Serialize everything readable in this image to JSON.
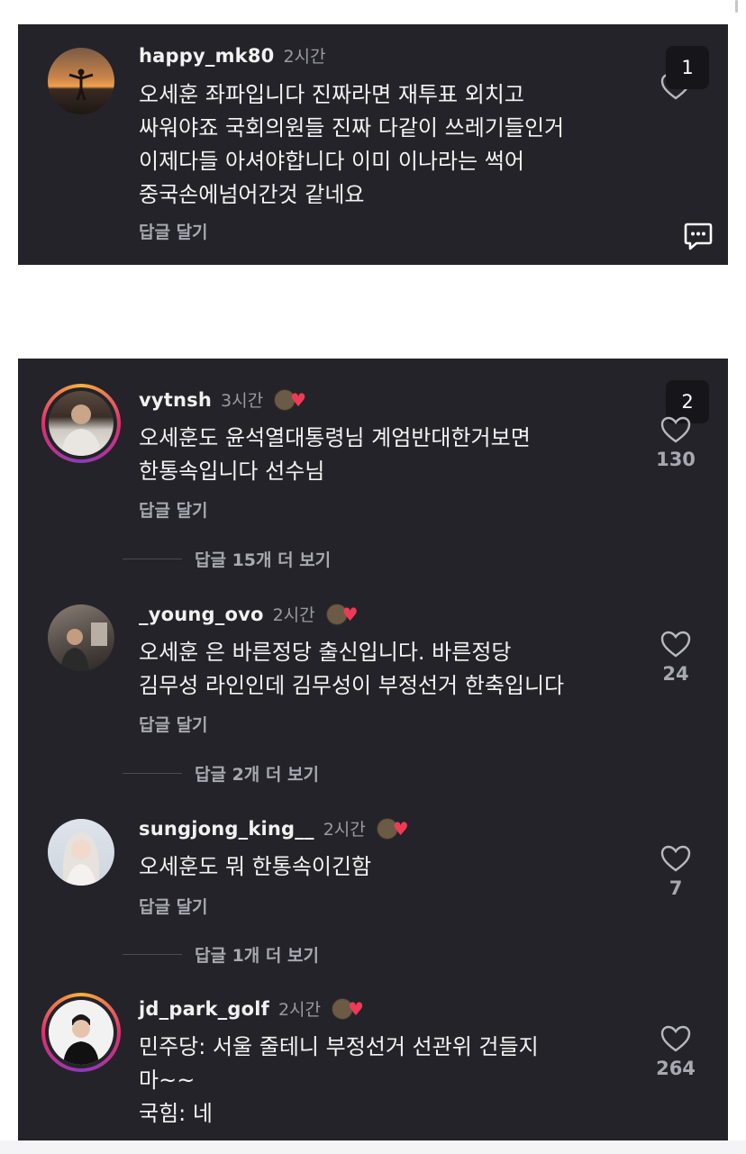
{
  "comments_top": [
    {
      "username": "happy_mk80",
      "time": "2시간",
      "lines": [
        "오세훈 좌파입니다 진짜라면 재투표 외치고",
        "싸워야죠 국회의원들 진짜 다같이 쓰레기들인거",
        "이제다들 아셔야합니다 이미 이나라는 썩어",
        "중국손에넘어간것 같네요"
      ],
      "reply_label": "답글 달기",
      "avatar_icon": "sunset-person-avatar"
    }
  ],
  "badge_1": "1",
  "badge_2": "2",
  "chat_icon": "comment-bubble-icon",
  "comments": [
    {
      "username": "vytnsh",
      "time": "3시간",
      "lines": [
        "오세훈도 윤석열대통령님 계엄반대한거보면",
        "한통속입니다 선수님"
      ],
      "reply_label": "답글 달기",
      "likes": "130",
      "more_replies": "답글 15개 더 보기"
    },
    {
      "username": "_young_ovo",
      "time": "2시간",
      "lines": [
        "오세훈 은 바른정당 출신입니다. 바른정당",
        "김무성 라인인데 김무성이 부정선거 한축입니다"
      ],
      "reply_label": "답글 달기",
      "likes": "24",
      "more_replies": "답글 2개 더 보기"
    },
    {
      "username": "sungjong_king__",
      "time": "2시간",
      "lines": [
        "오세훈도 뭐 한통속이긴함"
      ],
      "reply_label": "답글 달기",
      "likes": "7",
      "more_replies": "답글 1개 더 보기"
    },
    {
      "username": "jd_park_golf",
      "time": "2시간",
      "lines": [
        "민주당: 서울 줄테니 부정선거 선관위 건들지",
        "마~~",
        "국힘: 네"
      ],
      "likes": "264"
    }
  ],
  "colors": {
    "panel_bg": "#232329",
    "text": "#f3f3f3",
    "muted": "#a8a8b0",
    "creator_heart": "#ef3a56"
  }
}
